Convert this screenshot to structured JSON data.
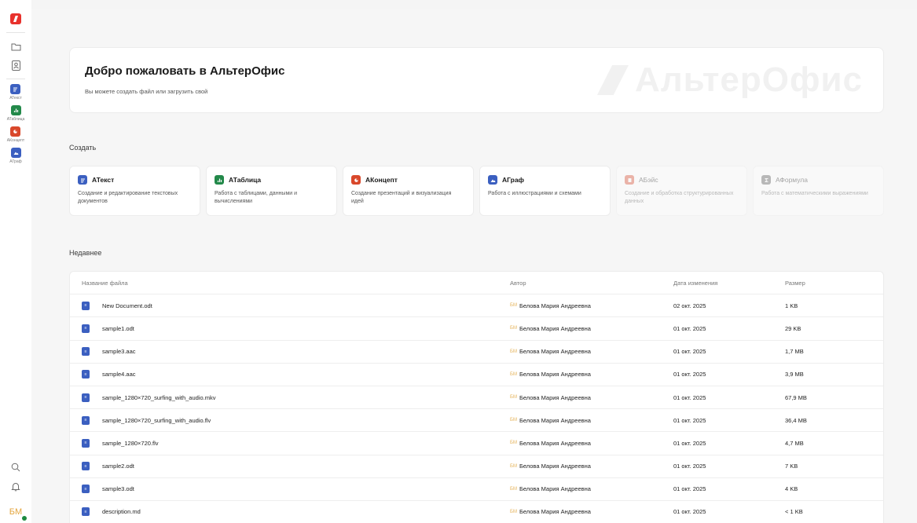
{
  "sidebar": {
    "apps": [
      {
        "label": "АТекст",
        "color": "#3b5fc0",
        "icon": "text-doc-icon"
      },
      {
        "label": "АТаблица",
        "color": "#23894a",
        "icon": "spreadsheet-icon"
      },
      {
        "label": "АКонцепт",
        "color": "#d9482b",
        "icon": "presentation-icon"
      },
      {
        "label": "АГраф",
        "color": "#3b5fc0",
        "icon": "graph-icon"
      }
    ],
    "avatar_initials": "БМ"
  },
  "welcome": {
    "title": "Добро пожаловать в АльтерОфис",
    "subtitle": "Вы можете создать файл или загрузить свой",
    "watermark": "АльтерОфис"
  },
  "create": {
    "title": "Создать",
    "cards": [
      {
        "title": "АТекст",
        "desc": "Создание и редактирование текстовых документов",
        "color": "#3b5fc0"
      },
      {
        "title": "АТаблица",
        "desc": "Работа с таблицами, данными и вычислениями",
        "color": "#23894a"
      },
      {
        "title": "АКонцепт",
        "desc": "Создание презентаций и визуализация идей",
        "color": "#d9482b"
      },
      {
        "title": "АГраф",
        "desc": "Работа с иллюстрациями и схемами",
        "color": "#3b5fc0"
      },
      {
        "title": "АБэйс",
        "desc": "Создание и обработка структурированных данных",
        "color": "#d9482b"
      },
      {
        "title": "АФормула",
        "desc": "Работа с математическими выражениями",
        "color": "#555555"
      }
    ]
  },
  "recent": {
    "title": "Недавнее",
    "columns": {
      "name": "Название файла",
      "author": "Автор",
      "date": "Дата изменения",
      "size": "Размер"
    },
    "rows": [
      {
        "name": "New Document.odt",
        "initials": "БМ",
        "author": "Белова Мария Андреевна",
        "date": "02 окт. 2025",
        "size": "1 KB"
      },
      {
        "name": "sample1.odt",
        "initials": "БМ",
        "author": "Белова Мария Андреевна",
        "date": "01 окт. 2025",
        "size": "29 KB"
      },
      {
        "name": "sample3.aac",
        "initials": "БМ",
        "author": "Белова Мария Андреевна",
        "date": "01 окт. 2025",
        "size": "1,7 MB"
      },
      {
        "name": "sample4.aac",
        "initials": "БМ",
        "author": "Белова Мария Андреевна",
        "date": "01 окт. 2025",
        "size": "3,9 MB"
      },
      {
        "name": "sample_1280×720_surfing_with_audio.mkv",
        "initials": "БМ",
        "author": "Белова Мария Андреевна",
        "date": "01 окт. 2025",
        "size": "67,9 MB"
      },
      {
        "name": "sample_1280×720_surfing_with_audio.flv",
        "initials": "БМ",
        "author": "Белова Мария Андреевна",
        "date": "01 окт. 2025",
        "size": "36,4 MB"
      },
      {
        "name": "sample_1280×720.flv",
        "initials": "БМ",
        "author": "Белова Мария Андреевна",
        "date": "01 окт. 2025",
        "size": "4,7 MB"
      },
      {
        "name": "sample2.odt",
        "initials": "БМ",
        "author": "Белова Мария Андреевна",
        "date": "01 окт. 2025",
        "size": "7 KB"
      },
      {
        "name": "sample3.odt",
        "initials": "БМ",
        "author": "Белова Мария Андреевна",
        "date": "01 окт. 2025",
        "size": "4 KB"
      },
      {
        "name": "description.md",
        "initials": "БМ",
        "author": "Белова Мария Андреевна",
        "date": "01 окт. 2025",
        "size": "< 1 KB"
      }
    ]
  }
}
